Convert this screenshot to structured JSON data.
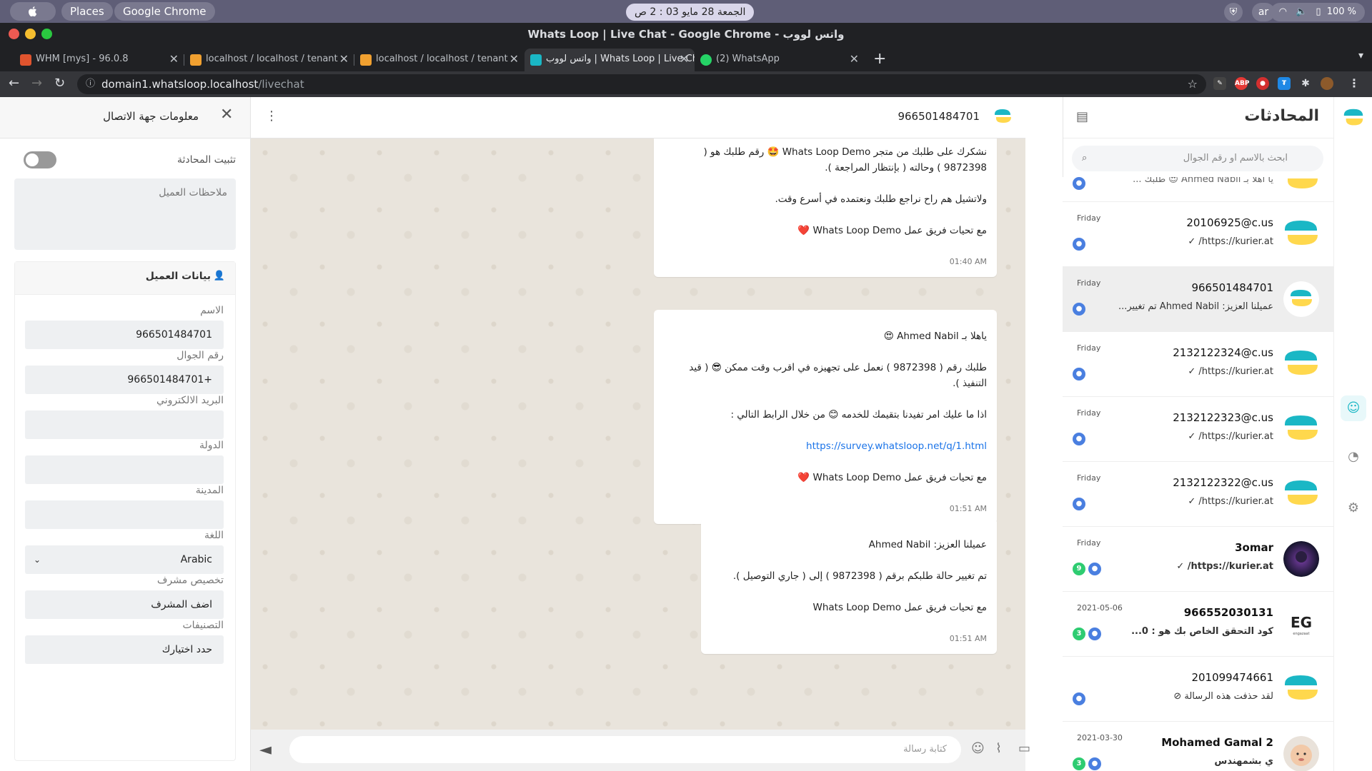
{
  "os": {
    "apple": "",
    "places": "Places",
    "app": "Google Chrome",
    "clock": "الجمعة 28 مايو   03 : 2 ص",
    "lang": "ar",
    "battery": "100 %"
  },
  "window": {
    "title": "Whats Loop | Live Chat - Google Chrome - واتس لووب"
  },
  "tabs": [
    {
      "label": "WHM [mys] - 96.0.8",
      "color": "#e0542e"
    },
    {
      "label": "localhost / localhost / tenant",
      "color": "#f0a030"
    },
    {
      "label": "localhost / localhost / tenant",
      "color": "#f0a030"
    },
    {
      "label": "واتس لووب | Whats Loop | Live Chat",
      "color": "#1ab7c5"
    },
    {
      "label": "(2) WhatsApp",
      "color": "#25d366"
    }
  ],
  "address": {
    "host": "domain1.whatsloop.localhost",
    "path": "/livechat"
  },
  "conversations": {
    "title": "المحادثات",
    "search_placeholder": "ابحث بالاسم او رقم الجوال",
    "items": [
      {
        "name": "",
        "preview": "يا اهلا بـ Ahmed Nabil 😍 طلبك ...",
        "time": "",
        "badge": "",
        "avatar": "logo",
        "partial": true
      },
      {
        "name": "20106925@c.us",
        "preview": "https://kurier.at/ ✓",
        "time": "Friday",
        "badge": "",
        "avatar": "logo"
      },
      {
        "name": "966501484701",
        "preview": "عميلنا العزيز: Ahmed Nabil تم تغيير...",
        "time": "Friday",
        "badge": "",
        "avatar": "logo-white",
        "active": true
      },
      {
        "name": "2132122324@c.us",
        "preview": "https://kurier.at/ ✓",
        "time": "Friday",
        "badge": "",
        "avatar": "logo"
      },
      {
        "name": "2132122323@c.us",
        "preview": "https://kurier.at/ ✓",
        "time": "Friday",
        "badge": "",
        "avatar": "logo"
      },
      {
        "name": "2132122322@c.us",
        "preview": "https://kurier.at/ ✓",
        "time": "Friday",
        "badge": "",
        "avatar": "logo"
      },
      {
        "name": "3omar",
        "preview": "https://kurier.at/ ✓",
        "time": "Friday",
        "badge": "9",
        "avatar": "photo-dark",
        "bold": true
      },
      {
        "name": "966552030131",
        "preview": "كود التحقق الخاص بك هو : 0...",
        "time": "2021-05-06",
        "badge": "3",
        "avatar": "eg",
        "bold": true
      },
      {
        "name": "201099474661",
        "preview": "لقد حذفت هذه الرسالة ⊘",
        "time": "",
        "badge": "",
        "avatar": "logo"
      },
      {
        "name": "Mohamed Gamal 2",
        "preview": "ي بشمهندس",
        "time": "2021-03-30",
        "badge": "3",
        "avatar": "photo-baby",
        "bold": true
      }
    ]
  },
  "chat": {
    "contact_number": "966501484701",
    "composer_placeholder": "كتابة رسالة",
    "messages": [
      {
        "lines": [
          "نشكرك على طلبك من متجر Whats Loop Demo 🤩 رقم طلبك هو ( 9872398 ) وحالته ( بإنتظار المراجعة ).",
          "ولاتشيل هم راح نراجع طلبك ونعتمده في أسرع وقت.",
          "مع تحيات فريق عمل Whats Loop Demo ❤️"
        ],
        "time": "01:40 AM"
      },
      {
        "lines": [
          "ياهلا بـ Ahmed Nabil 😍",
          "طلبك رقم  ( 9872398 ) نعمل على تجهيزه في اقرب وقت ممكن 😎 ( قيد التنفيذ ).",
          "اذا ما عليك امر تفيدنا بتقيمك للخدمه 😊 من خلال الرابط التالي :",
          "https://survey.whatsloop.net/q/1.html",
          "مع تحيات فريق عمل Whats Loop Demo ❤️"
        ],
        "link_index": 3,
        "time": "01:51 AM"
      },
      {
        "lines": [
          "عميلنا العزيز: Ahmed Nabil",
          "تم تغيير حالة طلبكم برقم ( 9872398 ) إلى ( جاري التوصيل ).",
          "مع تحيات فريق عمل Whats Loop Demo"
        ],
        "time": "01:51 AM"
      }
    ]
  },
  "contact": {
    "title": "معلومات جهة الاتصال",
    "pin_label": "تثبيت المحادثة",
    "pin_on": false,
    "notes_placeholder": "ملاحظات العميل",
    "card_title": "بيانات العميل",
    "fields": [
      {
        "label": "الاسم",
        "value": "966501484701"
      },
      {
        "label": "رقم الجوال",
        "value": "+966501484701"
      },
      {
        "label": "البريد الالكتروني",
        "value": ""
      },
      {
        "label": "الدولة",
        "value": ""
      },
      {
        "label": "المدينة",
        "value": ""
      },
      {
        "label": "اللغة",
        "value": "Arabic",
        "select": true
      },
      {
        "label": "تخصيص مشرف",
        "value": "اضف المشرف"
      },
      {
        "label": "التصنيفات",
        "value": "حدد اختيارك"
      }
    ]
  },
  "colors": {
    "brand_teal": "#1ab7c5",
    "brand_yellow": "#ffd84d",
    "agent_blue": "#4a7fe0",
    "badge_green": "#2ecc71"
  }
}
